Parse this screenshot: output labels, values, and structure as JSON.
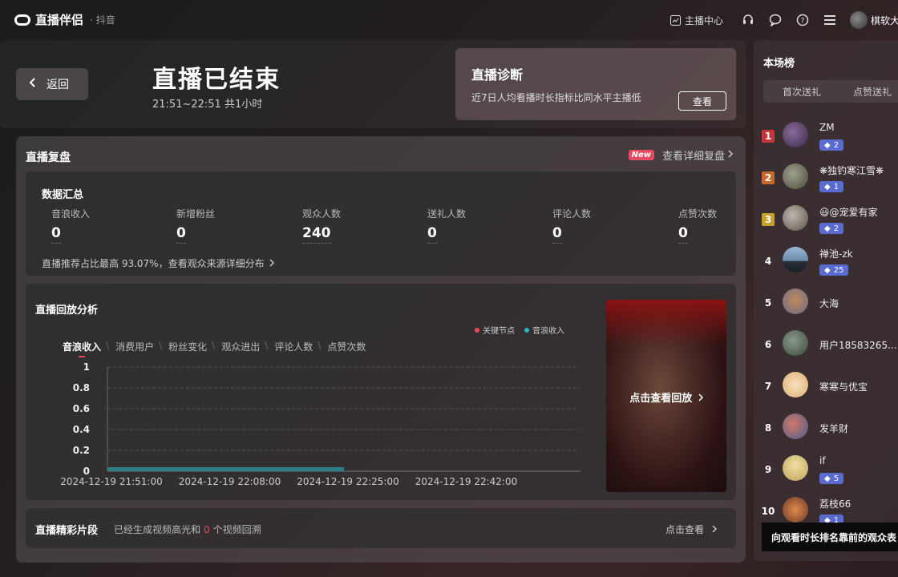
{
  "app": {
    "logo_text": "直播伴侣",
    "platform": "· 抖音"
  },
  "topbar": {
    "anchor_center": "主播中心",
    "username": "棋软大"
  },
  "header": {
    "back_label": "返回",
    "title": "直播已结束",
    "time_range": "21:51~22:51 共1小时",
    "diagnosis": {
      "title": "直播诊断",
      "desc": "近7日人均看播时长指标比同水平主播低",
      "button": "查看"
    }
  },
  "review": {
    "title": "直播复盘",
    "new_badge": "New",
    "detail_link": "查看详细复盘",
    "summary": {
      "title": "数据汇总",
      "metrics": [
        {
          "label": "音浪收入",
          "value": "0"
        },
        {
          "label": "新增粉丝",
          "value": "0"
        },
        {
          "label": "观众人数",
          "value": "240"
        },
        {
          "label": "送礼人数",
          "value": "0"
        },
        {
          "label": "评论人数",
          "value": "0"
        },
        {
          "label": "点赞次数",
          "value": "0"
        }
      ],
      "note": "直播推荐占比最高 93.07%，查看观众来源详细分布"
    },
    "replay": {
      "title": "直播回放分析",
      "tabs": [
        "音浪收入",
        "消费用户",
        "粉丝变化",
        "观众进出",
        "评论人数",
        "点赞次数"
      ],
      "video_text": "点击查看回放"
    },
    "clips": {
      "title": "直播精彩片段",
      "desc_prefix": "已经生成视频高光和",
      "count": "0",
      "desc_suffix": "个视频回溯",
      "link": "点击查看"
    }
  },
  "chart_data": {
    "type": "area",
    "legend": [
      {
        "name": "关键节点",
        "color": "#e84a5f"
      },
      {
        "name": "音浪收入",
        "color": "#2bb5c0"
      }
    ],
    "y_ticks": [
      "0",
      "0.2",
      "0.4",
      "0.6",
      "0.8",
      "1"
    ],
    "ylim": [
      0,
      1
    ],
    "x_ticks": [
      "2024-12-19 21:51:00",
      "2024-12-19 22:08:00",
      "2024-12-19 22:25:00",
      "2024-12-19 22:42:00"
    ],
    "xlim_minutes": [
      0,
      68
    ],
    "series": [
      {
        "name": "音浪收入",
        "x_minutes": [
          0,
          34
        ],
        "values": [
          0,
          0
        ]
      }
    ],
    "grid": true
  },
  "leaderboard": {
    "title": "本场榜",
    "tabs": [
      "首次送礼",
      "点赞送礼"
    ],
    "entries": [
      {
        "rank": "1",
        "name": "ZM",
        "badge": "2"
      },
      {
        "rank": "2",
        "name": "❋独钓寒江雪❋",
        "badge": "1"
      },
      {
        "rank": "3",
        "name": "😃@宠爱有家",
        "badge": "2"
      },
      {
        "rank": "4",
        "name": "禅池-zk",
        "badge": "25"
      },
      {
        "rank": "5",
        "name": "大海",
        "badge": ""
      },
      {
        "rank": "6",
        "name": "用户18583265...",
        "badge": ""
      },
      {
        "rank": "7",
        "name": "寒寒与优宝",
        "badge": ""
      },
      {
        "rank": "8",
        "name": "发羊财",
        "badge": ""
      },
      {
        "rank": "9",
        "name": "if",
        "badge": "5"
      },
      {
        "rank": "10",
        "name": "荔枝66",
        "badge": "1"
      }
    ],
    "tooltip": "向观看时长排名靠前的观众表"
  }
}
